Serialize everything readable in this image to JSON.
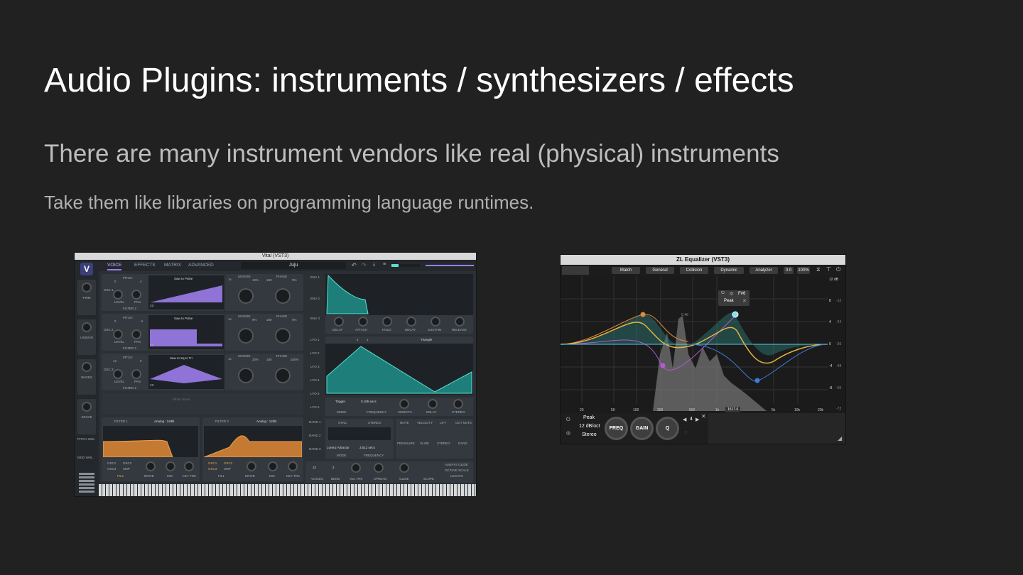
{
  "slide": {
    "title": "Audio Plugins: instruments / synthesizers / effects",
    "subtitle": "There are many instrument vendors like real (physical) instruments",
    "body": "Take them like libraries on programming language runtimes."
  },
  "vital": {
    "window_title": "Vital (VST3)",
    "tabs": [
      "VOICE",
      "EFFECTS",
      "MATRIX",
      "ADVANCED"
    ],
    "active_tab": "VOICE",
    "preset": "Juju",
    "oscillators": [
      {
        "label": "OSC 1",
        "wave": "Saw to Pulse",
        "pitch": "0",
        "pitch_fine": "4",
        "unison": "1x",
        "unison_pct": "10%",
        "phase": "180",
        "phase_pct": "0%"
      },
      {
        "label": "OSC 2",
        "wave": "Saw to Pulse",
        "pitch": "0",
        "pitch_fine": "-4",
        "unison": "1x",
        "unison_pct": "9%",
        "phase": "180",
        "phase_pct": "0%"
      },
      {
        "label": "OSC 3",
        "wave": "Saw to Sq to Tri",
        "pitch": "12",
        "pitch_fine": "6",
        "unison": "1x",
        "unison_pct": "20%",
        "phase": "180",
        "phase_pct": "100%"
      }
    ],
    "osc_knob_labels": [
      "LEVEL",
      "PAN"
    ],
    "osc_header_labels": {
      "pitch": "PITCH",
      "unison": "UNISON",
      "phase": "PHASE",
      "filter": "FILTER 2",
      "mode": "2D"
    },
    "sample_label": "White Noise",
    "macros": [
      "PWM",
      "UNISON",
      "WAVES",
      "SPACE",
      "PITCH WHL",
      "MOD WHL"
    ],
    "envelopes": [
      "ENV 1",
      "ENV 2",
      "ENV 3"
    ],
    "env_knobs": [
      "DELAY",
      "ATTACK",
      "HOLD",
      "DECAY",
      "SUSTAIN",
      "RELEASE"
    ],
    "lfos": [
      "LFO 1",
      "LFO 2",
      "LFO 3",
      "LFO 4",
      "LFO 5",
      "LFO 6"
    ],
    "lfo_shape": "Triangle",
    "lfo_values": [
      "4",
      "1"
    ],
    "lfo_controls": {
      "trigger": "Trigger",
      "time": "0.185 secs",
      "knobs": [
        "MODE",
        "FREQUENCY",
        "SMOOTH",
        "DELAY",
        "STEREO"
      ]
    },
    "randoms": [
      "RAND 1",
      "RAND 2",
      "RAND 3"
    ],
    "random_tabs": [
      "SYNC",
      "STEREO"
    ],
    "random_controls": {
      "type": "Lorenz Attractor",
      "time": "3.512 secs",
      "knobs": [
        "MODE",
        "FREQUENCY"
      ]
    },
    "voice_mods": [
      "NOTE",
      "VELOCITY",
      "LIFT",
      "OCT NOTE",
      "PRESSURE",
      "SLIDE",
      "STEREO",
      "RAND"
    ],
    "filters": [
      {
        "label": "FILTER 1",
        "type": "Analog : 24dB"
      },
      {
        "label": "FILTER 2",
        "type": "Analog : 12dB"
      }
    ],
    "filter_routes": [
      "OSC1",
      "OSC2",
      "OSC3",
      "SMP",
      "FIL2",
      "FIL1"
    ],
    "filter_knobs": [
      "DRIVE",
      "MIX",
      "KEY TRK"
    ],
    "voice_section": {
      "voices": "12",
      "bend": "2",
      "labels": [
        "VOICES",
        "BEND",
        "VEL TRK",
        "SPREAD",
        "GLIDE",
        "SLOPE"
      ]
    },
    "glide_options": [
      "ALWAYS GLIDE",
      "OCTAVE SCALE",
      "LEGATO"
    ],
    "colors": {
      "accent": "#9d7dff",
      "teal": "#58e0d2",
      "filter": "#d88a3e",
      "bg": "#2b3035"
    }
  },
  "zl": {
    "window_title": "ZL Equalizer (VST3)",
    "buttons": [
      "Match",
      "General",
      "Collision",
      "Dynamic",
      "Analyzer"
    ],
    "readout_gain": "0.0",
    "readout_scale": "100%",
    "freq_labels": [
      "20",
      "50",
      "100",
      "200",
      "500",
      "1k",
      "1517.6",
      "5k",
      "10k",
      "20k"
    ],
    "db_right_labels": [
      "12 dB",
      "8",
      "4",
      "0",
      "-4",
      "-8"
    ],
    "db_inner_labels": [
      "-12",
      "-24",
      "-36",
      "-48",
      "-60",
      "-72"
    ],
    "annotation": "5.48",
    "popup": {
      "note": "F#6",
      "type": "Peak"
    },
    "band": {
      "type": "Peak",
      "slope": "12 dB/oct",
      "mode": "Stereo",
      "index": "4"
    },
    "dials": [
      "FREQ",
      "GAIN",
      "Q"
    ],
    "colors": {
      "yellow": "#e6b340",
      "cyan": "#58c9e6",
      "purple": "#b35ad6",
      "orange": "#e08a3c",
      "blue": "#3d7bd9"
    }
  }
}
